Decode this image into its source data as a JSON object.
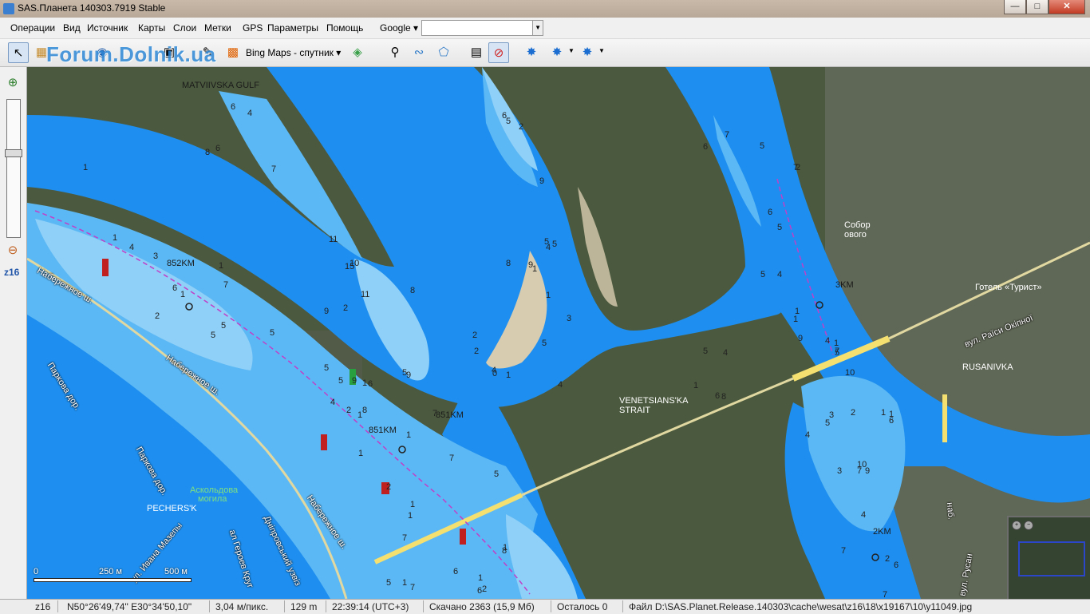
{
  "window": {
    "title": "SAS.Планета 140303.7919 Stable",
    "minimize": "0",
    "maximize": "1",
    "close": "r"
  },
  "menu": {
    "items": [
      "Операции",
      "Вид",
      "Источник",
      "Карты",
      "Слои",
      "Метки",
      "GPS",
      "Параметры",
      "Помощь"
    ],
    "map_source": "Google",
    "search_value": ""
  },
  "toolbar": {
    "watermark": "Forum.Dolnik.ua",
    "layer_name": "Bing Maps - спутник"
  },
  "zoom": {
    "level_label": "z16",
    "slider_level": 0.38
  },
  "map": {
    "place_labels": [
      "MATVIIVSKA GULF",
      "852KM",
      "851KM",
      "851KM",
      "VENETSIANS'KA",
      "STRAIT",
      "3KM",
      "2KM",
      "RUSANIVKA",
      "PECHERS'K",
      "Собор",
      "ового",
      "Готель «Турист»",
      "Аскольдова",
      "могила"
    ],
    "road_labels": [
      "Набережное ш.",
      "Набережное ш.",
      "Набережное ш.",
      "Паркова дор.",
      "Паркова дор.",
      "ул. Ивана Мазепы",
      "ал Героев Круг",
      "Дніпровський узвіз",
      "вул. Раїси Окіпної",
      "наб.",
      "вул. Русан"
    ],
    "depths": [
      "1",
      "6",
      "4",
      "7",
      "6",
      "8",
      "1",
      "4",
      "3",
      "6",
      "1",
      "7",
      "5",
      "9",
      "2",
      "5",
      "9",
      "4",
      "1",
      "5",
      "8",
      "1",
      "2",
      "7",
      "6",
      "1",
      "5",
      "5",
      "1",
      "1",
      "9",
      "1",
      "8",
      "4",
      "4",
      "0",
      "8",
      "2",
      "2",
      "5",
      "9",
      "2",
      "1",
      "1",
      "6",
      "7",
      "7",
      "1",
      "1",
      "6",
      "2",
      "1",
      "8",
      "5",
      "6",
      "9",
      "4",
      "3",
      "2",
      "5",
      "5",
      "6",
      "8",
      "1",
      "5",
      "4",
      "1",
      "3",
      "7",
      "4",
      "7",
      "3",
      "1",
      "9",
      "9",
      "6",
      "7",
      "5",
      "10",
      "10",
      "7",
      "2",
      "5",
      "7",
      "6",
      "4",
      "5",
      "5",
      "6",
      "1",
      "4",
      "1",
      "2",
      "1",
      "5",
      "4",
      "7",
      "2",
      "6",
      "5",
      "1",
      "7",
      "11",
      "10",
      "11",
      "15",
      "1",
      "5",
      "5",
      "2"
    ],
    "scale": {
      "zero": "0",
      "mid": "250 м",
      "end": "500 м"
    }
  },
  "status": {
    "zoom": "z16",
    "coords": "N50°26'49,74\" E30°34'50,10\"",
    "resolution": "3,04 м/пикс.",
    "altitude": "129 m",
    "time": "22:39:14 (UTC+3)",
    "downloaded": "Скачано 2363 (15,9 Мб)",
    "remaining": "Осталось 0",
    "file": "Файл D:\\SAS.Planet.Release.140303\\cache\\wesat\\z16\\18\\x19167\\10\\y11049.jpg"
  },
  "colors": {
    "land": "#4b5a3e",
    "deep_water": "#1e8ff0",
    "mid_water": "#5cb8f4",
    "shallow_water": "#8fd0f8",
    "sand": "#d8ccb0",
    "bridge": "#f4e070",
    "route": "#c040c8"
  }
}
